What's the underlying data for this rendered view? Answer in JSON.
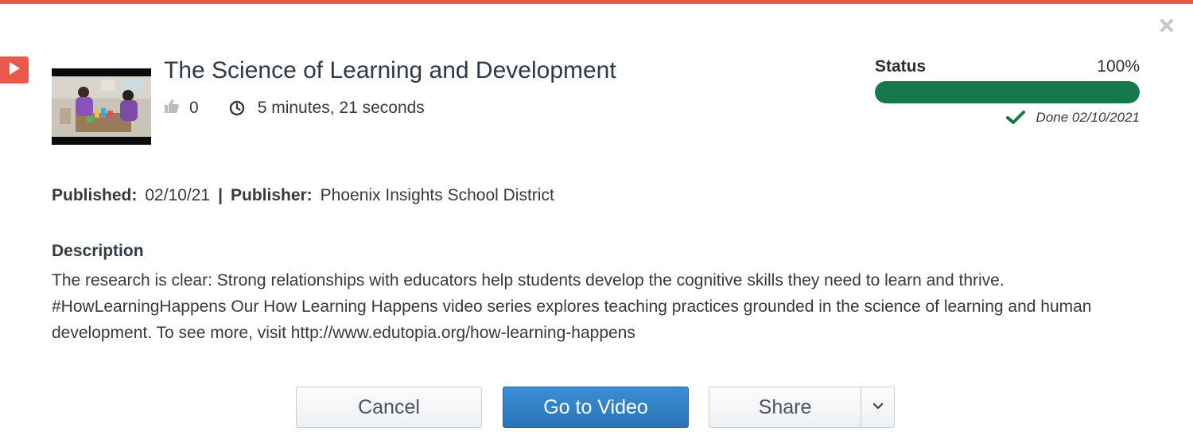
{
  "dialog": {
    "close_icon": "close-icon",
    "type_icon": "video-play-icon",
    "accent_color": "#e8594b"
  },
  "video": {
    "title": "The Science of Learning and Development",
    "likes": "0",
    "duration": "5 minutes, 21 seconds"
  },
  "status": {
    "label": "Status",
    "percent_text": "100%",
    "progress": 1.0,
    "done_text": "Done 02/10/2021",
    "bar_color": "#157a4a"
  },
  "publish": {
    "published_label": "Published:",
    "published_value": "02/10/21",
    "separator": "|",
    "publisher_label": "Publisher:",
    "publisher_value": "Phoenix Insights School District"
  },
  "description": {
    "heading": "Description",
    "text": "The research is clear: Strong relationships with educators help students develop the cognitive skills they need to learn and thrive. #HowLearningHappens Our How Learning Happens video series explores teaching practices grounded in the science of learning and human development. To see more, visit http://www.edutopia.org/how-learning-happens"
  },
  "actions": {
    "cancel_label": "Cancel",
    "go_label": "Go to Video",
    "share_label": "Share",
    "primary_color": "#2f7fc4"
  }
}
